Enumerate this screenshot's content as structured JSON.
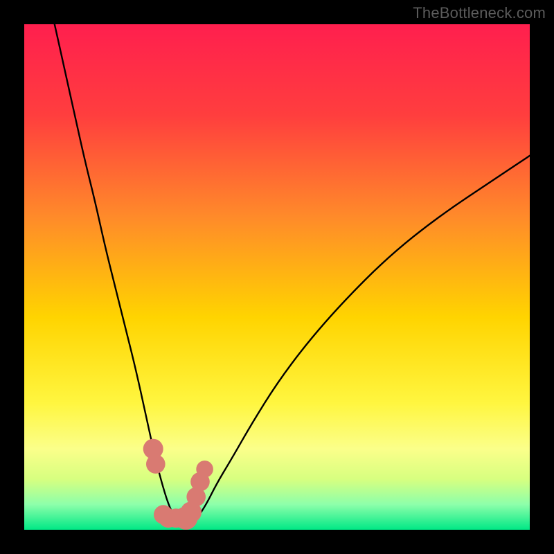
{
  "watermark": "TheBottleneck.com",
  "colors": {
    "frame": "#000000",
    "gradient_top": "#ff1f4e",
    "gradient_mid1": "#ff6a2a",
    "gradient_mid2": "#ffd400",
    "gradient_mid3": "#fff640",
    "gradient_low": "#d7ff66",
    "gradient_bottom": "#00e886",
    "curve": "#000000",
    "marker": "#d97a72"
  },
  "chart_data": {
    "type": "line",
    "title": "",
    "xlabel": "",
    "ylabel": "",
    "xlim": [
      0,
      100
    ],
    "ylim": [
      0,
      100
    ],
    "series": [
      {
        "name": "bottleneck-curve",
        "x": [
          6,
          8,
          10,
          12,
          14,
          16,
          18,
          20,
          22,
          24,
          25.5,
          27,
          28.5,
          30,
          31,
          32,
          34,
          36,
          38,
          41,
          45,
          50,
          56,
          63,
          72,
          82,
          94,
          100
        ],
        "y": [
          100,
          91,
          82,
          73,
          65,
          56,
          48,
          40,
          32,
          23,
          16,
          10,
          5,
          2,
          1,
          1,
          2,
          5,
          9,
          14,
          21,
          29,
          37,
          45,
          54,
          62,
          70,
          74
        ]
      }
    ],
    "markers": [
      {
        "x": 25.5,
        "y": 16,
        "r": 1.3
      },
      {
        "x": 26.0,
        "y": 13,
        "r": 1.2
      },
      {
        "x": 27.5,
        "y": 3.0,
        "r": 1.2
      },
      {
        "x": 28.5,
        "y": 2.3,
        "r": 1.2
      },
      {
        "x": 30.0,
        "y": 2.3,
        "r": 1.2
      },
      {
        "x": 31.0,
        "y": 2.3,
        "r": 1.2
      },
      {
        "x": 32.0,
        "y": 2.3,
        "r": 1.6
      },
      {
        "x": 33.0,
        "y": 3.5,
        "r": 1.4
      },
      {
        "x": 34.0,
        "y": 6.5,
        "r": 1.2
      },
      {
        "x": 34.8,
        "y": 9.5,
        "r": 1.2
      },
      {
        "x": 35.7,
        "y": 12.0,
        "r": 1.0
      }
    ],
    "grid": false,
    "legend": false
  }
}
